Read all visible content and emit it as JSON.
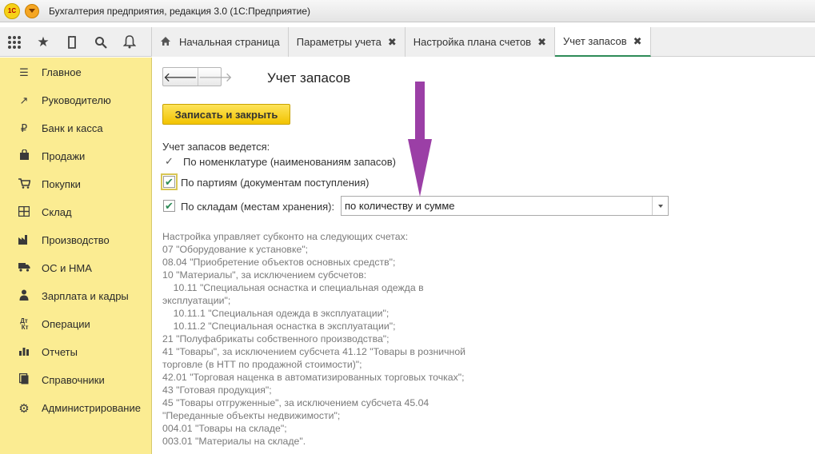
{
  "window": {
    "title": "Бухгалтерия предприятия, редакция 3.0 (1С:Предприятие)",
    "logo_text": "1С"
  },
  "quick_icons": [
    "apps-grid-icon",
    "star-icon",
    "history-icon",
    "search-icon",
    "bell-icon"
  ],
  "tabs": [
    {
      "label": "Начальная страница",
      "closable": false
    },
    {
      "label": "Параметры учета",
      "closable": true
    },
    {
      "label": "Настройка плана счетов",
      "closable": true
    },
    {
      "label": "Учет запасов",
      "closable": true,
      "active": true
    }
  ],
  "close_glyph": "✖",
  "sidebar": {
    "items": [
      {
        "label": "Главное",
        "icon": "menu-lines-icon"
      },
      {
        "label": "Руководителю",
        "icon": "trend-icon"
      },
      {
        "label": "Банк и касса",
        "icon": "ruble-icon"
      },
      {
        "label": "Продажи",
        "icon": "bag-icon"
      },
      {
        "label": "Покупки",
        "icon": "cart-icon"
      },
      {
        "label": "Склад",
        "icon": "warehouse-icon"
      },
      {
        "label": "Производство",
        "icon": "factory-icon"
      },
      {
        "label": "ОС и НМА",
        "icon": "truck-icon"
      },
      {
        "label": "Зарплата и кадры",
        "icon": "person-icon"
      },
      {
        "label": "Операции",
        "icon": "dt-kt-icon"
      },
      {
        "label": "Отчеты",
        "icon": "bar-chart-icon"
      },
      {
        "label": "Справочники",
        "icon": "book-icon"
      },
      {
        "label": "Администрирование",
        "icon": "gear-icon"
      }
    ]
  },
  "form": {
    "title": "Учет запасов",
    "save_label": "Записать и закрыть",
    "accounting_label": "Учет запасов ведется:",
    "by_nomenclature": "По номенклатуре (наименованиям запасов)",
    "by_batches": {
      "label": "По партиям (документам поступления)",
      "checked": true
    },
    "by_warehouses": {
      "label": "По складам (местам хранения):",
      "checked": true,
      "value": "по количеству и сумме"
    },
    "info_lines": [
      "Настройка управляет субконто на следующих счетах:",
      "07 \"Оборудование к установке\";",
      "08.04 \"Приобретение объектов основных средств\";",
      "10 \"Материалы\", за исключением субсчетов:",
      "    10.11 \"Специальная оснастка и специальная одежда в",
      "эксплуатации\";",
      "    10.11.1 \"Специальная одежда в эксплуатации\";",
      "    10.11.2 \"Специальная оснастка в эксплуатации\";",
      "21 \"Полуфабрикаты собственного производства\";",
      "41 \"Товары\", за исключением субсчета 41.12 \"Товары в розничной",
      "торговле (в НТТ по продажной стоимости)\";",
      "42.01 \"Торговая наценка в автоматизированных торговых точках\";",
      "43 \"Готовая продукция\";",
      "45 \"Товары отгруженные\", за исключением субсчета 45.04",
      "\"Переданные объекты недвижимости\";",
      "004.01 \"Товары на складе\";",
      "003.01 \"Материалы на складе\"."
    ]
  },
  "colors": {
    "sidebar_bg": "#fbec92",
    "save_button": "#f2c300",
    "annotation_arrow": "#9b3fa6",
    "check": "#2e8b57"
  }
}
